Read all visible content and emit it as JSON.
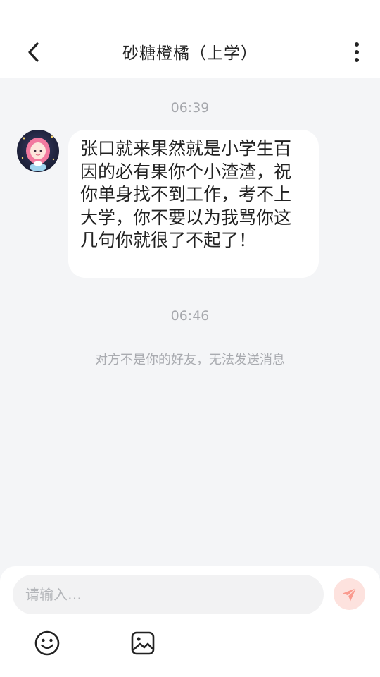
{
  "header": {
    "title": "砂糖橙橘（上学）"
  },
  "chat": {
    "time_1": "06:39",
    "message_1": "张口就来果然就是小学生百因的必有果你个小渣渣，祝你单身找不到工作，考不上大学，你不要以为我骂你这几句你就很了不起了！",
    "time_2": "06:46",
    "system_notice": "对方不是你的好友，无法发送消息"
  },
  "composer": {
    "input_placeholder": "请输入…",
    "input_value": ""
  },
  "icons": {
    "back": "chevron-left-icon",
    "more": "more-vertical-icon",
    "send": "paper-plane-icon",
    "emoji": "smiley-icon",
    "image": "image-icon"
  },
  "colors": {
    "background": "#f4f5f7",
    "bubble": "#ffffff",
    "send_button": "#fde2de",
    "send_icon": "#fa9a8e"
  }
}
